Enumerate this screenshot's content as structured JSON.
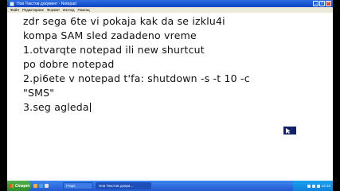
{
  "window": {
    "title": "Нов Текстов документ - Notepad",
    "controls": [
      "_",
      "□",
      "×"
    ]
  },
  "menu": [
    "Файл",
    "Редактиране",
    "Формат",
    "Изглед",
    "Помощ"
  ],
  "editor": {
    "lines": [
      "zdr sega 6te vi pokaja kak da se  izklu4i",
      "kompa SAM sled zadadeno vreme",
      "1.otvarqte notepad ili new shurtcut",
      "po dobre notepad",
      "2.pi6ete v notepad t'fa: shutdown -s -t 10 -c",
      "\"SMS\"",
      "3.seg agleda"
    ]
  },
  "taskbar": {
    "start": "Старт",
    "tasks": [
      "Fraps",
      "Нов Текстов докум..."
    ],
    "tray_icons": [
      "volume-icon",
      "network-icon",
      "shield-icon"
    ],
    "clock": "12:10"
  },
  "colors": {
    "titlebar": "#0a46c6",
    "taskbar": "#2458d0",
    "start": "#2f8a2a",
    "menubar": "#ece9d8"
  }
}
